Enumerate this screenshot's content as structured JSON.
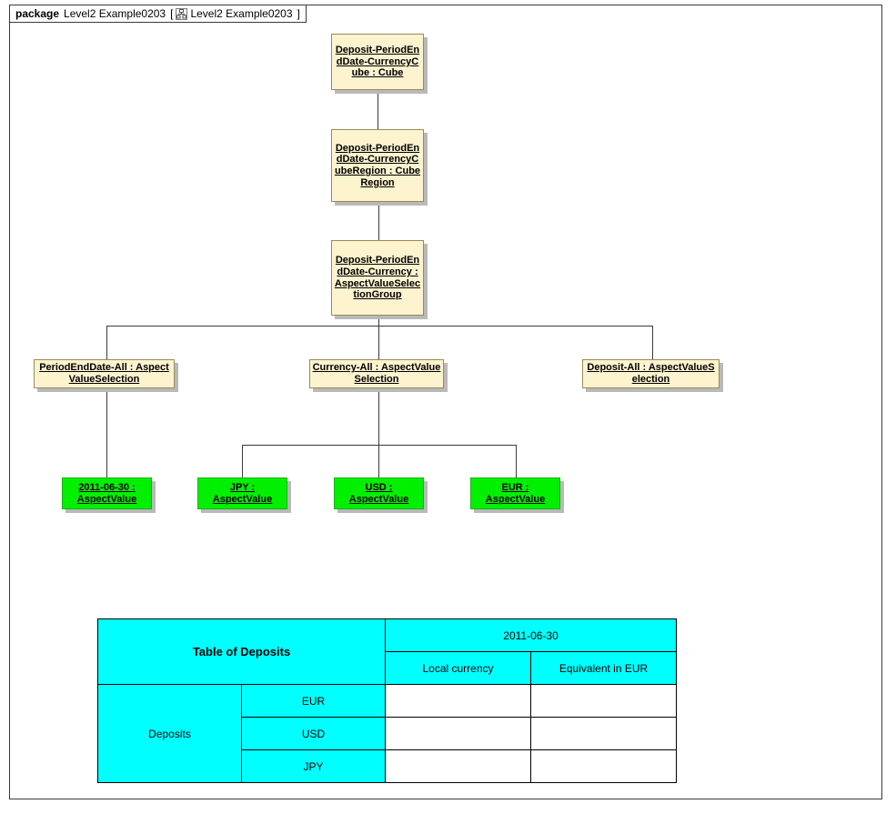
{
  "package": {
    "keyword": "package",
    "name": "Level2 Example0203",
    "bracket_open": "[",
    "bracket_close": "]",
    "diagram_name": "Level2 Example0203",
    "icon": "class-diagram-icon"
  },
  "colors": {
    "node_fill": "#fdf3cf",
    "node_border": "#9a8b55",
    "value_fill": "#00f000",
    "value_border": "#14b414",
    "shadow": "#b9b9b9",
    "line": "#3a3a3a",
    "table_header_fill": "#00ffff",
    "table_cell_fill": "#ffffff",
    "table_border": "#000000"
  },
  "nodes": [
    {
      "id": "cube",
      "name": "Deposit-PeriodEndDate-CurrencyCube",
      "type": "Cube",
      "label": "Deposit-PeriodEndDate-CurrencyCube : Cube",
      "kind": "classifier"
    },
    {
      "id": "cuberegion",
      "name": "Deposit-PeriodEndDate-CurrencyCubeRegion",
      "type": "CubeRegion",
      "label": "Deposit-PeriodEndDate-CurrencyCubeRegion : CubeRegion",
      "kind": "classifier"
    },
    {
      "id": "avsg",
      "name": "Deposit-PeriodEndDate-Currency",
      "type": "AspectValueSelectionGroup",
      "label": "Deposit-PeriodEndDate-Currency : AspectValueSelectionGroup",
      "kind": "classifier"
    },
    {
      "id": "avs-periodenddate",
      "name": "PeriodEndDate-All",
      "type": "AspectValueSelection",
      "label": "PeriodEndDate-All : AspectValueSelection",
      "kind": "classifier"
    },
    {
      "id": "avs-currency",
      "name": "Currency-All",
      "type": "AspectValueSelection",
      "label": "Currency-All : AspectValueSelection",
      "kind": "classifier"
    },
    {
      "id": "avs-deposit",
      "name": "Deposit-All",
      "type": "AspectValueSelection",
      "label": "Deposit-All : AspectValueSelection",
      "kind": "classifier"
    },
    {
      "id": "av-date",
      "name": "2011-06-30",
      "type": "AspectValue",
      "label": "2011-06-30 : AspectValue",
      "kind": "value"
    },
    {
      "id": "av-jpy",
      "name": "JPY",
      "type": "AspectValue",
      "label": "JPY : AspectValue",
      "kind": "value"
    },
    {
      "id": "av-usd",
      "name": "USD",
      "type": "AspectValue",
      "label": "USD : AspectValue",
      "kind": "value"
    },
    {
      "id": "av-eur",
      "name": "EUR",
      "type": "AspectValue",
      "label": "EUR : AspectValue",
      "kind": "value"
    }
  ],
  "table": {
    "title": "Table of Deposits",
    "period_header": "2011-06-30",
    "sub_headers": [
      "Local currency",
      "Equivalent in EUR"
    ],
    "row_group_label": "Deposits",
    "rows": [
      {
        "currency": "EUR",
        "local_currency": "",
        "equivalent_in_eur": ""
      },
      {
        "currency": "USD",
        "local_currency": "",
        "equivalent_in_eur": ""
      },
      {
        "currency": "JPY",
        "local_currency": "",
        "equivalent_in_eur": ""
      }
    ]
  }
}
